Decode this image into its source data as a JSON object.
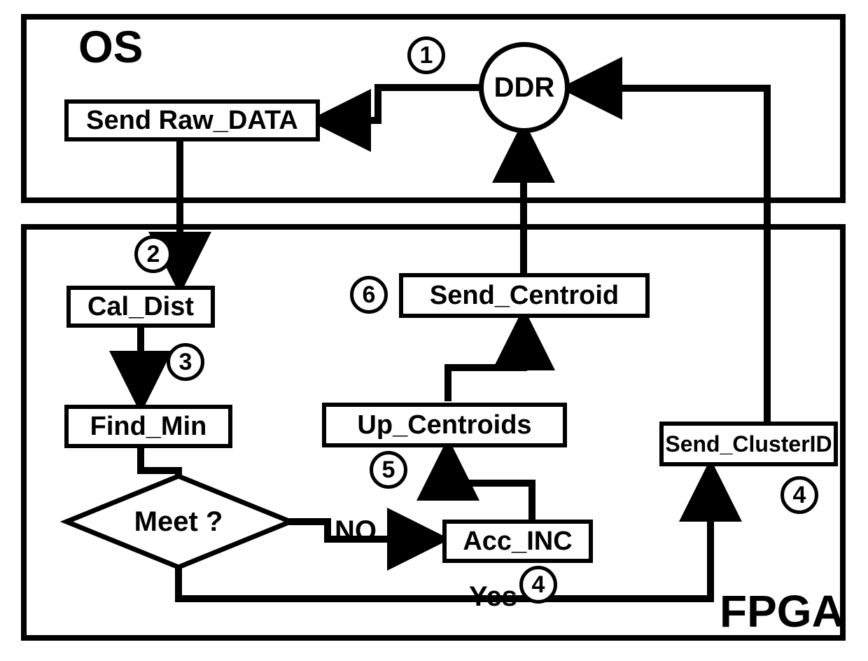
{
  "regions": {
    "os_label": "OS",
    "fpga_label": "FPGA"
  },
  "nodes": {
    "ddr": "DDR",
    "send_raw": "Send Raw_DATA",
    "cal_dist": "Cal_Dist",
    "find_min": "Find_Min",
    "meet": "Meet ?",
    "acc_inc": "Acc_INC",
    "up_centroids": "Up_Centroids",
    "send_centroid": "Send_Centroid",
    "send_clusterid": "Send_ClusterID"
  },
  "edges": {
    "yes": "Yes",
    "no": "NO"
  },
  "steps": {
    "s1": "1",
    "s2": "2",
    "s3": "3",
    "s4a": "4",
    "s4b": "4",
    "s5": "5",
    "s6": "6"
  }
}
